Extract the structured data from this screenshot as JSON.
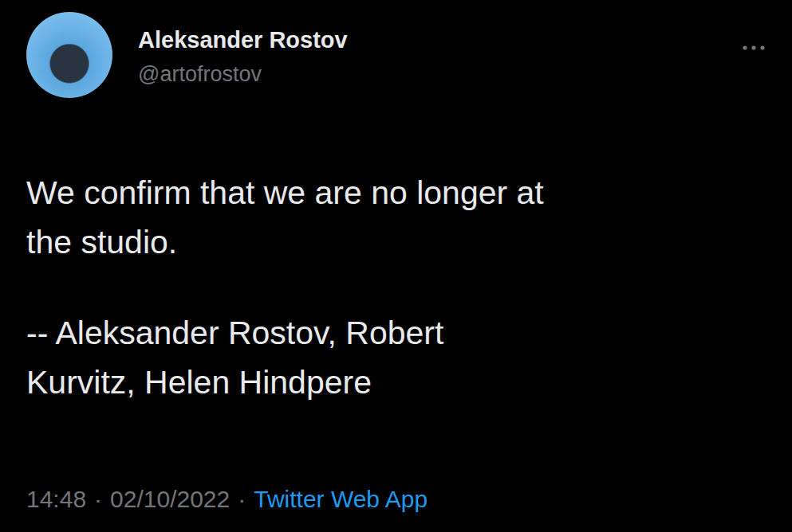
{
  "author": {
    "name": "Aleksander Rostov",
    "handle": "@artofrostov"
  },
  "tweet": {
    "paragraphs": [
      [
        "We confirm that we are no longer at",
        "the studio."
      ],
      [
        "-- Aleksander Rostov, Robert",
        "Kurvitz, Helen Hindpere"
      ]
    ]
  },
  "meta": {
    "time": "14:48",
    "separator": "·",
    "date": "02/10/2022",
    "source": "Twitter Web App"
  }
}
